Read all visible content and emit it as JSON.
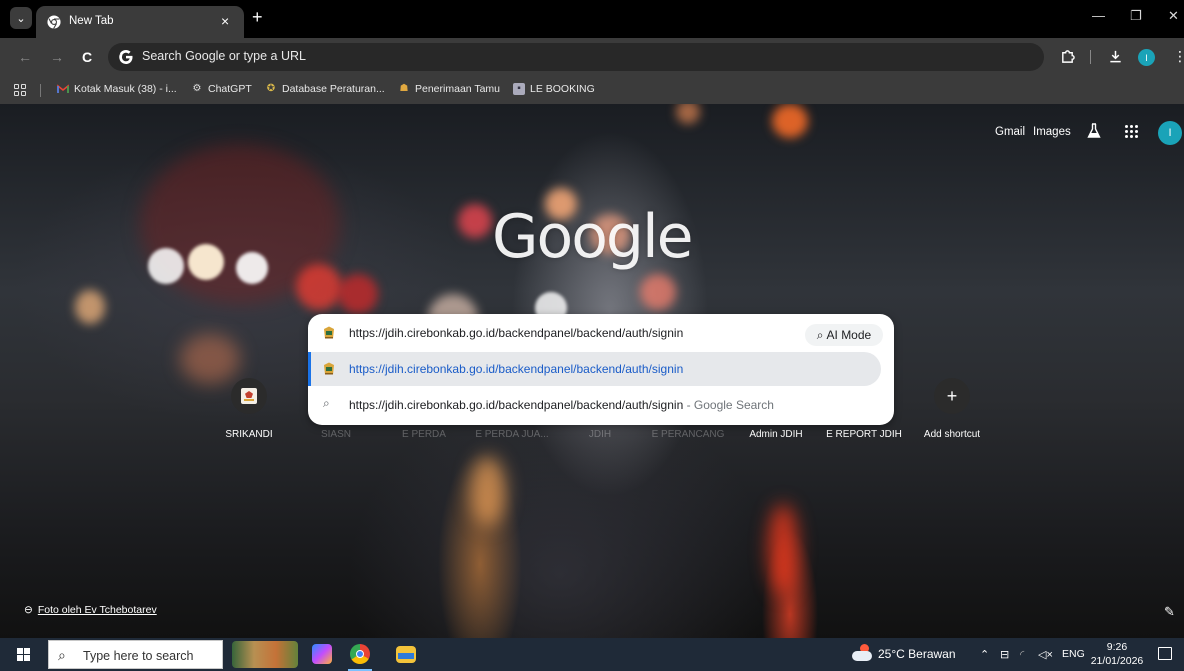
{
  "browser": {
    "tab": {
      "title": "New Tab",
      "close": "×"
    },
    "new_tab": "+",
    "omnibox": {
      "placeholder": "Search Google or type a URL"
    },
    "window_controls": {
      "minimize": "—",
      "restore": "❐",
      "close": "✕"
    },
    "bookmarks": [
      {
        "label": "Kotak Masuk (38) - i...",
        "icon": "gmail-icon"
      },
      {
        "label": "ChatGPT",
        "icon": "chatgpt-icon"
      },
      {
        "label": "Database Peraturan...",
        "icon": "database-icon"
      },
      {
        "label": "Penerimaan Tamu",
        "icon": "guest-icon"
      },
      {
        "label": "LE BOOKING",
        "icon": "booking-icon"
      }
    ],
    "profile_initial": "I"
  },
  "ntp": {
    "links": {
      "gmail": "Gmail",
      "images": "Images"
    },
    "account_initial": "I",
    "logo": "Google",
    "dropdown": {
      "input_value": "https://jdih.cirebonkab.go.id/backendpanel/backend/auth/signin",
      "ai_mode_label": "AI Mode",
      "suggestions": [
        {
          "text": "https://jdih.cirebonkab.go.id/backendpanel/backend/auth/signin",
          "suffix": "",
          "selected": true
        },
        {
          "text": "https://jdih.cirebonkab.go.id/backendpanel/backend/auth/signin",
          "suffix": " - Google Search",
          "selected": false
        }
      ]
    },
    "shortcuts": [
      {
        "label": "SRIKANDI"
      },
      {
        "label": "SIASN"
      },
      {
        "label": "E PERDA"
      },
      {
        "label": "E PERDA JUA..."
      },
      {
        "label": "JDIH"
      },
      {
        "label": "E PERANCANG"
      },
      {
        "label": "Admin JDIH"
      },
      {
        "label": "E REPORT JDIH"
      },
      {
        "label": "Add shortcut"
      }
    ],
    "add_shortcut_symbol": "+",
    "photo_credit": "Foto oleh Ev Tchebotarev"
  },
  "taskbar": {
    "search_placeholder": "Type here to search",
    "weather": "25°C  Berawan",
    "language": "ENG",
    "time": "9:26",
    "date": "21/01/2026"
  },
  "colors": {
    "accent": "#1a73e8",
    "profile": "#1aa3b8",
    "taskbar": "#1f2a38"
  }
}
